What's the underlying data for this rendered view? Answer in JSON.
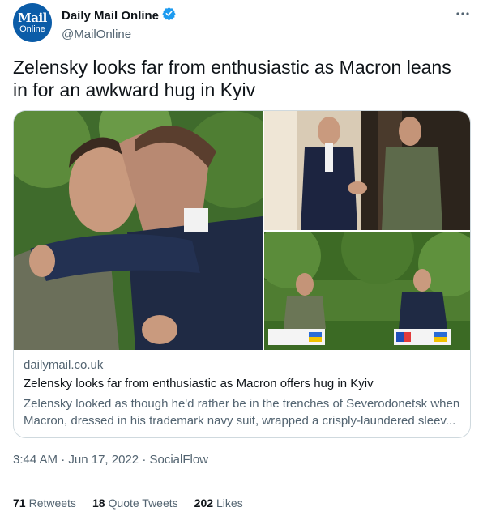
{
  "author": {
    "avatar_line1": "Mail",
    "avatar_line2": "Online",
    "display_name": "Daily Mail Online",
    "handle": "@MailOnline",
    "verified": true
  },
  "menu_icon": "more-horizontal-icon",
  "tweet_text": "Zelensky looks far from enthusiastic as Macron leans in for an awkward hug in Kyiv",
  "card": {
    "domain": "dailymail.co.uk",
    "title": "Zelensky looks far from enthusiastic as Macron offers hug in Kyiv",
    "description": "Zelensky looked as though he'd rather be in the trenches of Severodonetsk when Macron, dressed in his trademark navy suit, wrapped a crisply-laundered sleev..."
  },
  "meta": {
    "time": "3:44 AM",
    "date": "Jun 17, 2022",
    "source": "SocialFlow",
    "separator": "·"
  },
  "stats": {
    "retweets_count": "71",
    "retweets_label": "Retweets",
    "quotes_count": "18",
    "quotes_label": "Quote Tweets",
    "likes_count": "202",
    "likes_label": "Likes"
  },
  "colors": {
    "avatar_bg": "#0b5ca8",
    "verified": "#1d9bf0",
    "secondary_text": "#536471",
    "border": "#cfd9de"
  }
}
